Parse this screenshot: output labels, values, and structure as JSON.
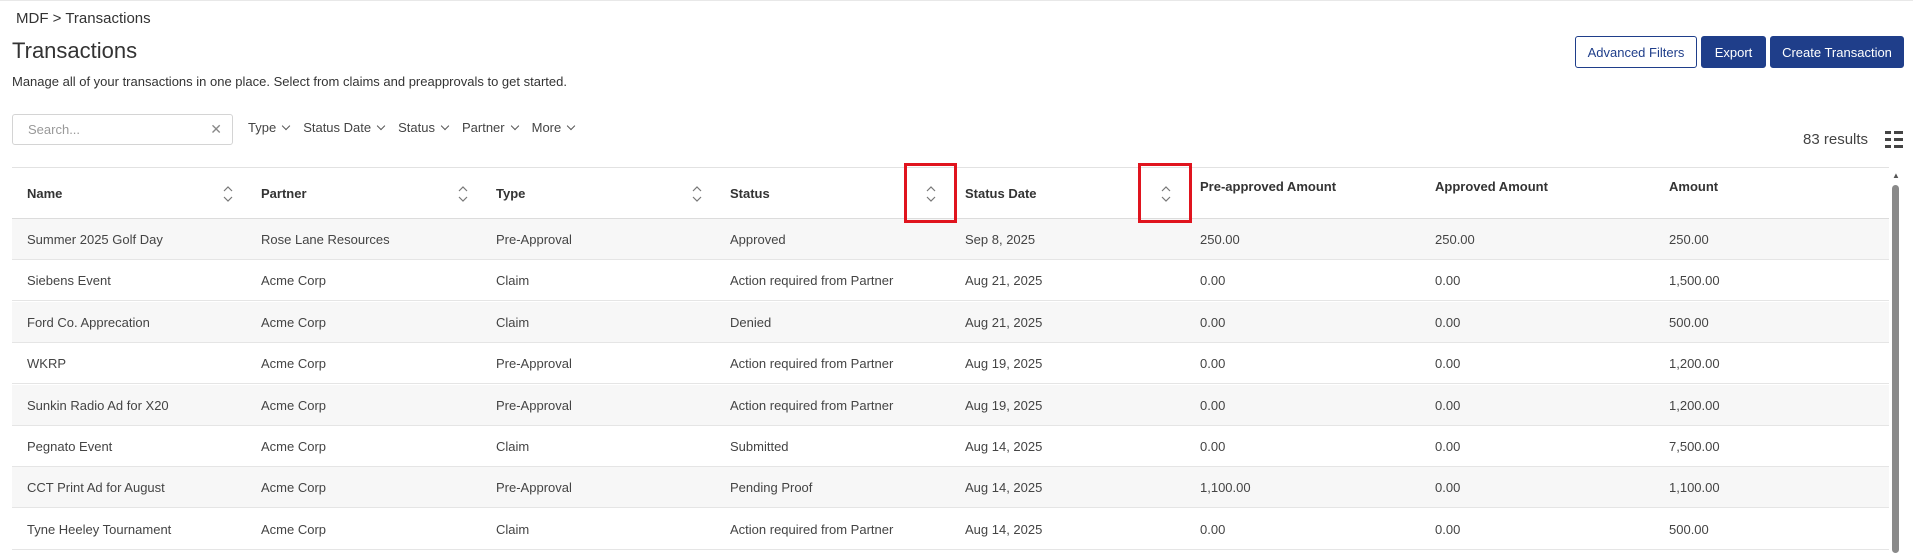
{
  "breadcrumb": "MDF > Transactions",
  "title": "Transactions",
  "subtitle": "Manage all of your transactions in one place. Select from claims and preapprovals to get started.",
  "actions": {
    "advanced_filters": "Advanced Filters",
    "export": "Export",
    "create": "Create Transaction"
  },
  "search": {
    "placeholder": "Search...",
    "value": ""
  },
  "filters": [
    "Type",
    "Status Date",
    "Status",
    "Partner",
    "More"
  ],
  "results": "83 results",
  "columns": [
    "Name",
    "Partner",
    "Type",
    "Status",
    "Status Date",
    "Pre-approved Amount",
    "Approved Amount",
    "Amount"
  ],
  "rows": [
    [
      "Summer 2025 Golf Day",
      "Rose Lane Resources",
      "Pre-Approval",
      "Approved",
      "Sep 8, 2025",
      "250.00",
      "250.00",
      "250.00"
    ],
    [
      "Siebens Event",
      "Acme Corp",
      "Claim",
      "Action required from Partner",
      "Aug 21, 2025",
      "0.00",
      "0.00",
      "1,500.00"
    ],
    [
      "Ford Co. Apprecation",
      "Acme Corp",
      "Claim",
      "Denied",
      "Aug 21, 2025",
      "0.00",
      "0.00",
      "500.00"
    ],
    [
      "WKRP",
      "Acme Corp",
      "Pre-Approval",
      "Action required from Partner",
      "Aug 19, 2025",
      "0.00",
      "0.00",
      "1,200.00"
    ],
    [
      "Sunkin Radio Ad for X20",
      "Acme Corp",
      "Pre-Approval",
      "Action required from Partner",
      "Aug 19, 2025",
      "0.00",
      "0.00",
      "1,200.00"
    ],
    [
      "Pegnato Event",
      "Acme Corp",
      "Claim",
      "Submitted",
      "Aug 14, 2025",
      "0.00",
      "0.00",
      "7,500.00"
    ],
    [
      "CCT Print Ad for August",
      "Acme Corp",
      "Pre-Approval",
      "Pending Proof",
      "Aug 14, 2025",
      "1,100.00",
      "0.00",
      "1,100.00"
    ],
    [
      "Tyne Heeley Tournament",
      "Acme Corp",
      "Claim",
      "Action required from Partner",
      "Aug 14, 2025",
      "0.00",
      "0.00",
      "500.00"
    ]
  ],
  "colors": {
    "primary": "#1f3e8a",
    "highlight": "#e0141e",
    "row_alt": "#f7f7f7"
  },
  "icons": {
    "sort": "sort-icon",
    "clear": "close-icon",
    "chevron": "chevron-down-icon",
    "view": "column-view-icon"
  }
}
